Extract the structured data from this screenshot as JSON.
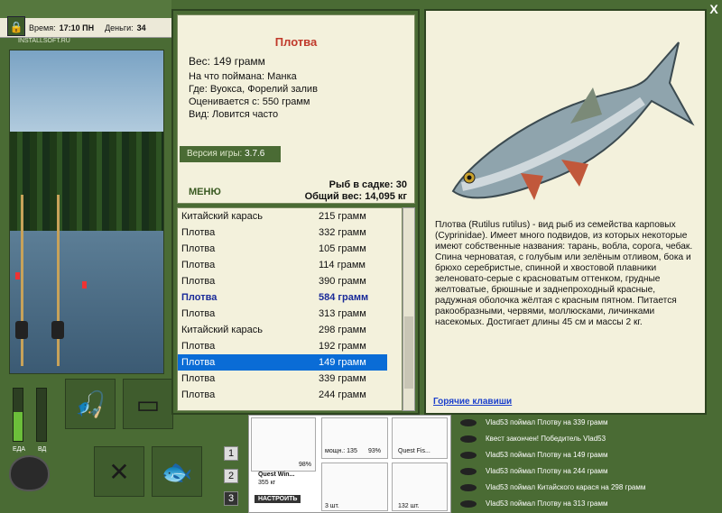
{
  "status_bar": {
    "time_label": "Время:",
    "time_value": "17:10 ПН",
    "money_label": "Деньги:",
    "money_value": "34"
  },
  "watermark": "INSTALLSOFT.RU",
  "meters": {
    "food_label": "ЕДА",
    "vd_label": "ВД",
    "food_level": 0.55,
    "vd_level": 0.0
  },
  "tabs": [
    "1",
    "2",
    "3"
  ],
  "fish_card": {
    "name": "Плотва",
    "weight": "Вес: 149 грамм",
    "bait": "На что поймана: Манка",
    "location": "Где: Вуокса, Форелий залив",
    "value": "Оценивается с: 550 грамм",
    "kind": "Вид: Ловится часто"
  },
  "version": {
    "label": "Версия игры:",
    "value": "3.7.6"
  },
  "menu_label": "МЕНЮ",
  "cage": {
    "count": "Рыб в садке: 30",
    "total": "Общий вес: 14,095 кг"
  },
  "catch_list": [
    {
      "name": "Китайский карась",
      "weight": "215 грамм",
      "state": ""
    },
    {
      "name": "Плотва",
      "weight": "332 грамм",
      "state": ""
    },
    {
      "name": "Плотва",
      "weight": "105 грамм",
      "state": ""
    },
    {
      "name": "Плотва",
      "weight": "114 грамм",
      "state": ""
    },
    {
      "name": "Плотва",
      "weight": "390 грамм",
      "state": ""
    },
    {
      "name": "Плотва",
      "weight": "584 грамм",
      "state": "hl"
    },
    {
      "name": "Плотва",
      "weight": "313 грамм",
      "state": ""
    },
    {
      "name": "Китайский карась",
      "weight": "298 грамм",
      "state": ""
    },
    {
      "name": "Плотва",
      "weight": "192 грамм",
      "state": ""
    },
    {
      "name": "Плотва",
      "weight": "149 грамм",
      "state": "sel"
    },
    {
      "name": "Плотва",
      "weight": "339 грамм",
      "state": ""
    },
    {
      "name": "Плотва",
      "weight": "244 грамм",
      "state": ""
    }
  ],
  "description": "Плотва (Rutilus rutilus) - вид рыб из семейства карповых (Cyprinidae). Имеет много подвидов, из которых некоторые имеют собственные названия: тарань, вобла, сорога, чебак. Спина черноватая, с голубым или зелёным отливом, бока и брюхо серебристые, спинной и хвостовой плавники зеленовато-серые с красноватым оттенком, грудные желтоватые, брюшные и заднепроходный красные, радужная оболочка жёлтая с красным пятном. Питается ракообразными, червями, моллюсками, личинками насекомых. Достигает длины 45 см и массы 2 кг.",
  "hotkeys_label": "Горячие клавиши",
  "inventory": {
    "rod_pct": "98%",
    "quest_label": "Quest Win...",
    "quest_weight": "355 кг",
    "setup_button": "НАСТРОИТЬ",
    "line_label": "мощн.: 135",
    "line_pct": "93%",
    "quest_fish": "Quest Fis...",
    "hook_count": "3 шт.",
    "bait_count": "132 шт."
  },
  "log": [
    "Vlad53 поймал Плотву на 339 грамм",
    "Квест закончен! Победитель Vlad53",
    "Vlad53 поймал Плотву на 149 грамм",
    "Vlad53 поймал Плотву на 244 грамм",
    "Vlad53 поймал Китайского карася на 298 грамм",
    "Vlad53 поймал Плотву на 313 грамм"
  ],
  "close_label": "X"
}
